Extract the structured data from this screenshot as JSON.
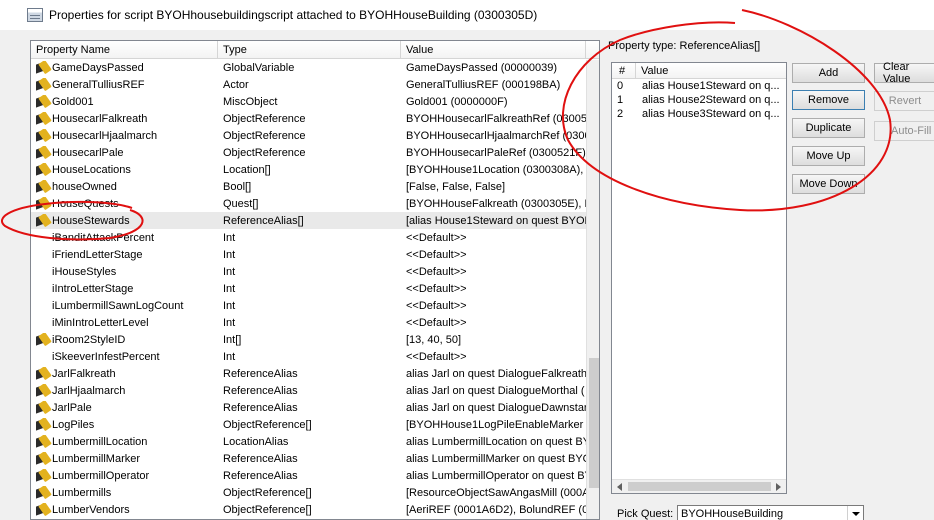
{
  "window": {
    "title": "Properties for script BYOHhousebuildingscript attached to BYOHHouseBuilding (0300305D)"
  },
  "columns": {
    "name": "Property Name",
    "type": "Type",
    "value": "Value"
  },
  "properties": [
    {
      "name": "GameDaysPassed",
      "type": "GlobalVariable",
      "value": "GameDaysPassed (00000039)",
      "icon": true
    },
    {
      "name": "GeneralTulliusREF",
      "type": "Actor",
      "value": "GeneralTulliusREF (000198BA)",
      "icon": true
    },
    {
      "name": "Gold001",
      "type": "MiscObject",
      "value": "Gold001 (0000000F)",
      "icon": true
    },
    {
      "name": "HousecarlFalkreath",
      "type": "ObjectReference",
      "value": "BYOHHousecarlFalkreathRef (030052",
      "icon": true
    },
    {
      "name": "HousecarlHjaalmarch",
      "type": "ObjectReference",
      "value": "BYOHHousecarlHjaalmarchRef (0300",
      "icon": true
    },
    {
      "name": "HousecarlPale",
      "type": "ObjectReference",
      "value": "BYOHHousecarlPaleRef (0300521F)",
      "icon": true
    },
    {
      "name": "HouseLocations",
      "type": "Location[]",
      "value": "[BYOHHouse1Location (0300308A), E",
      "icon": true
    },
    {
      "name": "houseOwned",
      "type": "Bool[]",
      "value": "[False, False, False]",
      "icon": true
    },
    {
      "name": "HouseQuests",
      "type": "Quest[]",
      "value": "[BYOHHouseFalkreath (0300305E), E",
      "icon": true
    },
    {
      "name": "HouseStewards",
      "type": "ReferenceAlias[]",
      "value": "[alias House1Steward on quest BYOH",
      "icon": true,
      "selected": true
    },
    {
      "name": "iBanditAttackPercent",
      "type": "Int",
      "value": "<<Default>>",
      "icon": false
    },
    {
      "name": "iFriendLetterStage",
      "type": "Int",
      "value": "<<Default>>",
      "icon": false
    },
    {
      "name": "iHouseStyles",
      "type": "Int",
      "value": "<<Default>>",
      "icon": false
    },
    {
      "name": "iIntroLetterStage",
      "type": "Int",
      "value": "<<Default>>",
      "icon": false
    },
    {
      "name": "iLumbermillSawnLogCount",
      "type": "Int",
      "value": "<<Default>>",
      "icon": false
    },
    {
      "name": "iMinIntroLetterLevel",
      "type": "Int",
      "value": "<<Default>>",
      "icon": false
    },
    {
      "name": "iRoom2StyleID",
      "type": "Int[]",
      "value": "[13, 40, 50]",
      "icon": true
    },
    {
      "name": "iSkeeverInfestPercent",
      "type": "Int",
      "value": "<<Default>>",
      "icon": false
    },
    {
      "name": "JarlFalkreath",
      "type": "ReferenceAlias",
      "value": "alias Jarl on quest DialogueFalkreath",
      "icon": true
    },
    {
      "name": "JarlHjaalmarch",
      "type": "ReferenceAlias",
      "value": "alias Jarl on quest DialogueMorthal (",
      "icon": true
    },
    {
      "name": "JarlPale",
      "type": "ReferenceAlias",
      "value": "alias Jarl on quest DialogueDawnstar",
      "icon": true
    },
    {
      "name": "LogPiles",
      "type": "ObjectReference[]",
      "value": "[BYOHHouse1LogPileEnableMarker (0",
      "icon": true
    },
    {
      "name": "LumbermillLocation",
      "type": "LocationAlias",
      "value": "alias LumbermillLocation on quest BYO",
      "icon": true
    },
    {
      "name": "LumbermillMarker",
      "type": "ReferenceAlias",
      "value": "alias LumbermillMarker on quest BYOH",
      "icon": true
    },
    {
      "name": "LumbermillOperator",
      "type": "ReferenceAlias",
      "value": "alias LumbermillOperator on quest BY",
      "icon": true
    },
    {
      "name": "Lumbermills",
      "type": "ObjectReference[]",
      "value": "[ResourceObjectSawAngasMill (000A",
      "icon": true
    },
    {
      "name": "LumberVendors",
      "type": "ObjectReference[]",
      "value": "[AeriREF (0001A6D2), BolundREF (00",
      "icon": true
    }
  ],
  "detail": {
    "property_type_label": "Property type: ReferenceAlias[]",
    "columns": {
      "num": "#",
      "value": "Value"
    },
    "items": [
      {
        "num": "0",
        "value": "alias House1Steward on q..."
      },
      {
        "num": "1",
        "value": "alias House2Steward on q..."
      },
      {
        "num": "2",
        "value": "alias House3Steward on q..."
      }
    ]
  },
  "buttons": {
    "add": "Add",
    "remove": "Remove",
    "duplicate": "Duplicate",
    "move_up": "Move Up",
    "move_down": "Move Down",
    "clear_value": "Clear Value",
    "revert": "Revert",
    "auto_fill": "Auto-Fill"
  },
  "pick_quest": {
    "label": "Pick Quest:",
    "value": "BYOHHouseBuilding"
  },
  "colors": {
    "annotation": "#e01010",
    "selected_row": "#e9e9e9"
  }
}
